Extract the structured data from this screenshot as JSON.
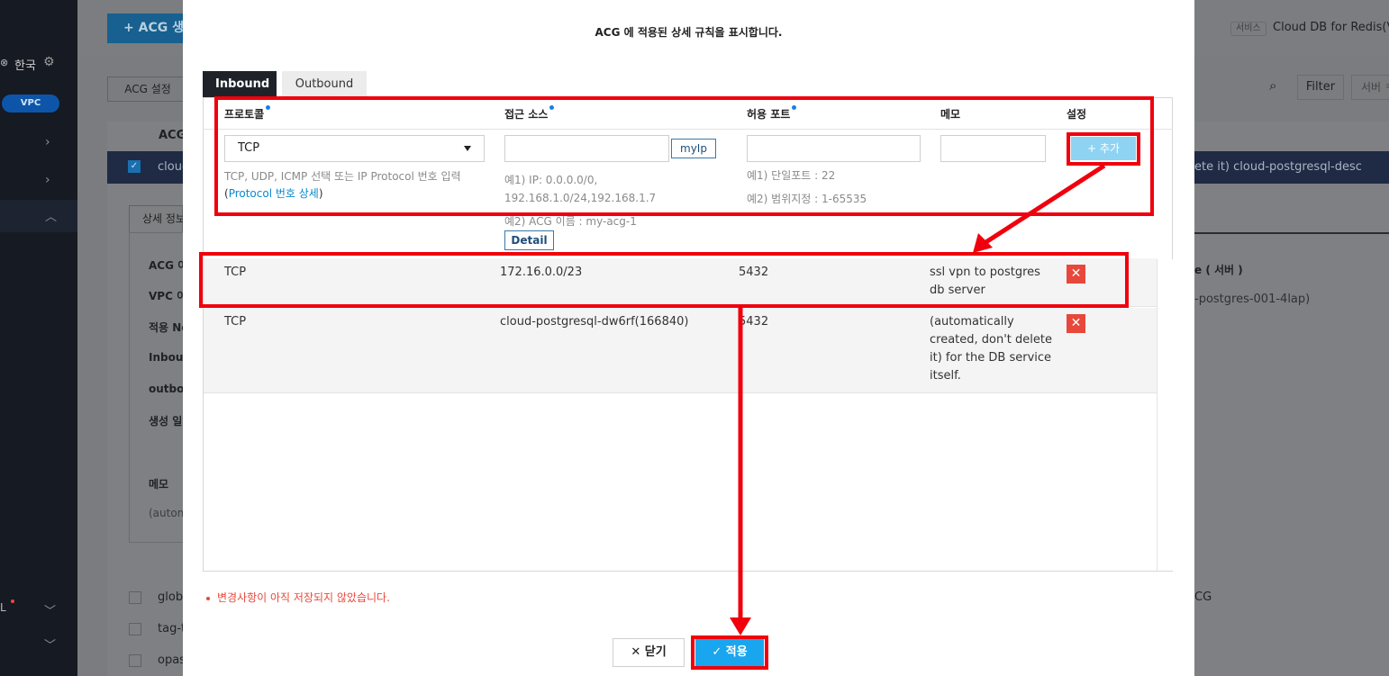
{
  "background": {
    "sidebar": {
      "language": "한국",
      "vpc_badge": "VPC",
      "bottom_item": "L"
    },
    "toolbar": {
      "create_acg_button": "+ ACG 생",
      "service_label": "서비스",
      "service_value": "Cloud DB for Redis(VP",
      "acg_settings_button": "ACG 설정",
      "filter_button": "Filter",
      "search_placeholder": "서버 ㅋ"
    },
    "table": {
      "header": "ACG",
      "selected_row_name": "cloud",
      "selected_row_desc": "ete it) cloud-postgresql-desc",
      "rows": [
        "globa",
        "tag-t",
        "opas"
      ],
      "right_row_text": "CG"
    },
    "detail": {
      "tab": "상세 정보",
      "fields": [
        "ACG 이",
        "VPC 이",
        "적용 Ne",
        "Inbour",
        "outbou",
        "생성 일"
      ],
      "memo_label": "메모",
      "memo_value": "(autom",
      "right_header": "e ( 서버 )",
      "right_value": "-postgres-001-4lap)"
    }
  },
  "modal": {
    "title": "ACG 에 적용된 상세 규칙을 표시합니다.",
    "tabs": [
      {
        "label": "Inbound",
        "active": true
      },
      {
        "label": "Outbound",
        "active": false
      }
    ],
    "columns": {
      "protocol": "프로토콜",
      "source": "접근 소스",
      "port": "허용 포트",
      "memo": "메모",
      "settings": "설정"
    },
    "form": {
      "protocol_value": "TCP",
      "protocol_hint": "TCP, UDP, ICMP 선택 또는 IP Protocol 번호 입력",
      "protocol_link_open": "(",
      "protocol_link": "Protocol 번호 상세",
      "protocol_link_close": ")",
      "source_value": "",
      "myip_button": "myIp",
      "source_hint_1": "예1) IP: 0.0.0.0/0,",
      "source_hint_2": "192.168.1.0/24,192.168.1.7",
      "source_hint_3": "예2) ACG 이름 : my-acg-1",
      "detail_button": "Detail",
      "port_value": "",
      "port_hint_1": "예1) 단일포트 : 22",
      "port_hint_2": "예2) 범위지정 : 1-65535",
      "memo_value": "",
      "add_button": "+ 추가"
    },
    "rules": [
      {
        "protocol": "TCP",
        "source": "172.16.0.0/23",
        "port": "5432",
        "memo_lines": [
          "ssl vpn to postgres",
          "db server"
        ]
      },
      {
        "protocol": "TCP",
        "source": "cloud-postgresql-dw6rf(166840)",
        "port": "5432",
        "memo_lines": [
          "(automatically",
          "created, don't delete",
          "it) for the DB service",
          "itself."
        ]
      }
    ],
    "warning": "변경사항이 아직 저장되지 않았습니다.",
    "close_button": "✕ 닫기",
    "apply_button": "✓ 적용"
  },
  "colors": {
    "annotation_red": "#f0000c",
    "apply_blue": "#1aa6ee",
    "delete_red": "#e8483b",
    "link_blue": "#0a88cf"
  }
}
